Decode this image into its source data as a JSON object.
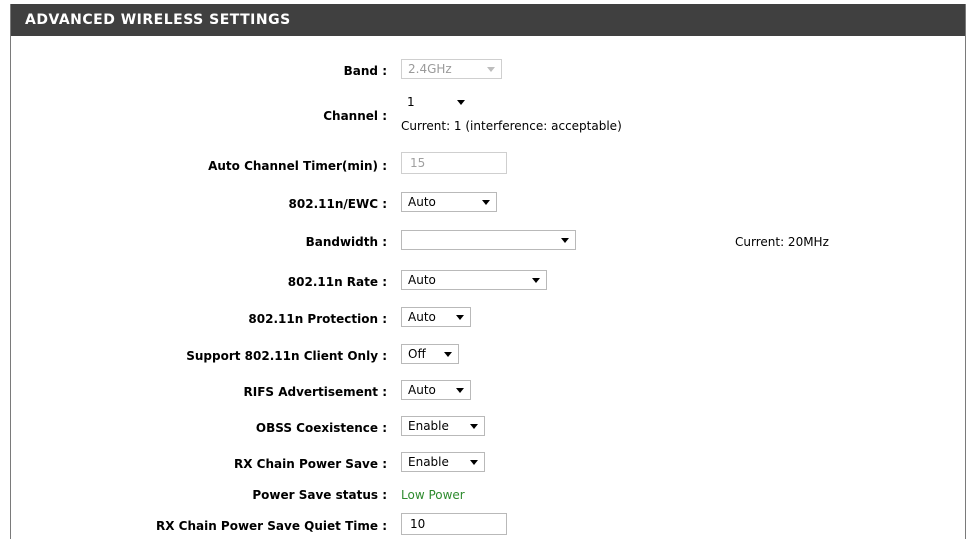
{
  "section": {
    "title": "ADVANCED WIRELESS SETTINGS"
  },
  "fields": {
    "band": {
      "label": "Band :",
      "value": "2.4GHz"
    },
    "channel": {
      "label": "Channel :",
      "value": "1",
      "current": "Current: 1 (interference: acceptable)"
    },
    "auto_channel_timer": {
      "label": "Auto Channel Timer(min) :",
      "value": "15"
    },
    "ewc": {
      "label": "802.11n/EWC :",
      "value": "Auto"
    },
    "bandwidth": {
      "label": "Bandwidth :",
      "value": "",
      "current": "Current: 20MHz"
    },
    "rate": {
      "label": "802.11n Rate :",
      "value": "Auto"
    },
    "protection": {
      "label": "802.11n Protection :",
      "value": "Auto"
    },
    "client_only": {
      "label": "Support 802.11n Client Only :",
      "value": "Off"
    },
    "rifs": {
      "label": "RIFS Advertisement :",
      "value": "Auto"
    },
    "obss": {
      "label": "OBSS Coexistence :",
      "value": "Enable"
    },
    "rx_power_save": {
      "label": "RX Chain Power Save :",
      "value": "Enable"
    },
    "power_save_status": {
      "label": "Power Save status :",
      "value": "Low Power"
    },
    "quiet_time": {
      "label": "RX Chain Power Save Quiet Time :",
      "value": "10"
    }
  },
  "colors": {
    "header_bg": "#404040",
    "status_green": "#2e8b2e"
  },
  "icons": {
    "dropdown": "chevron-down-icon"
  }
}
